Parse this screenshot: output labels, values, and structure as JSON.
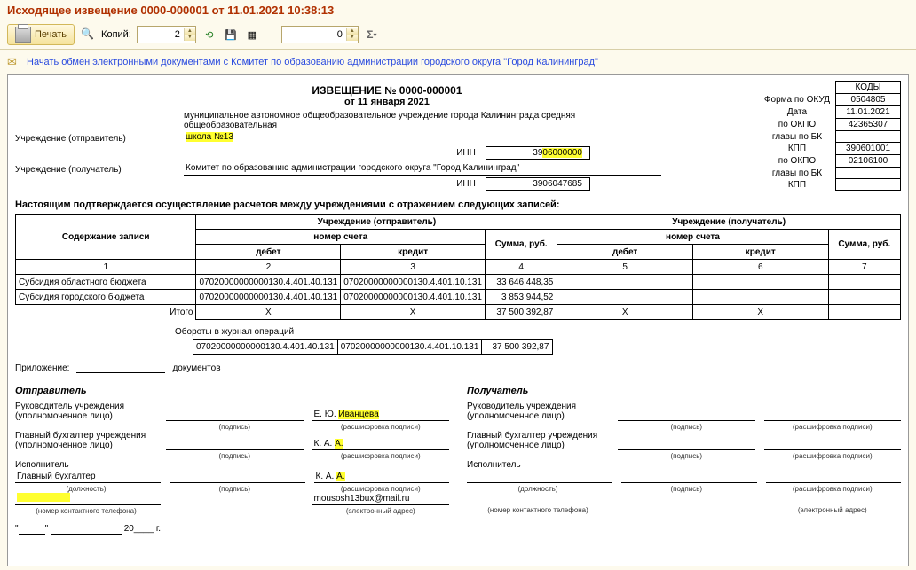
{
  "window_title": "Исходящее извещение 0000-000001 от 11.01.2021 10:38:13",
  "toolbar": {
    "print_label": "Печать",
    "copies_label": "Копий:",
    "copies_value": "2",
    "page_value": "0"
  },
  "exchange_link": "Начать обмен электронными документами с Комитет по образованию администрации городского округа \"Город Калининград\"",
  "kody": {
    "header": "КОДЫ",
    "form_okud_lbl": "Форма по ОКУД",
    "form_okud": "0504805",
    "date_lbl": "Дата",
    "date": "11.01.2021",
    "okpo1_lbl": "по ОКПО",
    "okpo1": "42365307",
    "glavy_bk1_lbl": "главы по БК",
    "glavy_bk1": "",
    "kpp1_lbl": "КПП",
    "kpp1": "390601001",
    "okpo2_lbl": "по ОКПО",
    "okpo2": "02106100",
    "glavy_bk2_lbl": "главы по БК",
    "glavy_bk2": "",
    "kpp2_lbl": "КПП",
    "kpp2": ""
  },
  "header": {
    "title": "ИЗВЕЩЕНИЕ № 0000-000001",
    "date_line": "от 11 января 2021"
  },
  "sender": {
    "label": "Учреждение (отправитель)",
    "name_part1": "муниципальное  автономное общеобразовательное учреждение  города Калининграда средняя общеобразовательная",
    "name_part2": "школа",
    "name_hl": "№13",
    "inn_lbl": "ИНН",
    "inn_vis": "39",
    "inn_hl": "06000000"
  },
  "recipient": {
    "label": "Учреждение (получатель)",
    "name": "Комитет по образованию администрации городского округа \"Город Калининград\"",
    "inn_lbl": "ИНН",
    "inn": "3906047685"
  },
  "confirm_text": "Настоящим подтверждается осуществление расчетов между учреждениями с отражением следующих записей:",
  "grid": {
    "headers": {
      "col1": "Содержание записи",
      "sender": "Учреждение (отправитель)",
      "recipient": "Учреждение (получатель)",
      "nomer": "номер счета",
      "summa": "Сумма, руб.",
      "debet": "дебет",
      "kredit": "кредит",
      "n1": "1",
      "n2": "2",
      "n3": "3",
      "n4": "4",
      "n5": "5",
      "n6": "6",
      "n7": "7"
    },
    "rows": [
      {
        "name": "Субсидия областного бюджета",
        "debet_s": "07020000000000130.4.401.40.131",
        "kredit_s": "07020000000000130.4.401.10.131",
        "sum_s": "33 646 448,35",
        "debet_r": "",
        "kredit_r": "",
        "sum_r": ""
      },
      {
        "name": "Субсидия городского бюджета",
        "debet_s": "07020000000000130.4.401.40.131",
        "kredit_s": "07020000000000130.4.401.10.131",
        "sum_s": "3 853 944,52",
        "debet_r": "",
        "kredit_r": "",
        "sum_r": ""
      }
    ],
    "itogo": {
      "label": "Итого",
      "debet_s": "Х",
      "kredit_s": "Х",
      "sum_s": "37 500 392,87",
      "debet_r": "Х",
      "kredit_r": "Х",
      "sum_r": ""
    },
    "oboroty_lbl": "Обороты в журнал операций",
    "oboroty": {
      "debet": "07020000000000130.4.401.40.131",
      "kredit": "07020000000000130.4.401.10.131",
      "sum": "37 500 392,87"
    }
  },
  "prilozhenie": {
    "label": "Приложение:",
    "doc_label": "документов"
  },
  "sig": {
    "sender_title": "Отправитель",
    "recipient_title": "Получатель",
    "head_lbl": "Руководитель учреждения",
    "head_sub": "(уполномоченное лицо)",
    "chief_acc_lbl": "Главный бухгалтер учреждения",
    "chief_acc_sub": "(уполномоченное лицо)",
    "exec_lbl": "Исполнитель",
    "exec_pos": "Главный бухгалтер",
    "sub_sign": "(подпись)",
    "sub_decode": "(расшифровка подписи)",
    "sub_pos": "(должность)",
    "sub_phone": "(номер контактного телефона)",
    "sub_email": "(электронный адрес)",
    "s_head_name_pre": "Е. Ю. ",
    "s_head_name_hl": "Иванцева",
    "s_acc_name_pre": "К. А. ",
    "s_acc_name_hl": "А.",
    "s_exec_name_pre": "К. А. ",
    "s_exec_name_hl": "А.",
    "s_email": "mousosh13bux@mail.ru"
  },
  "date_footer": {
    "q1": "\"",
    "q2": "\"",
    "year_label": "20____ г."
  }
}
